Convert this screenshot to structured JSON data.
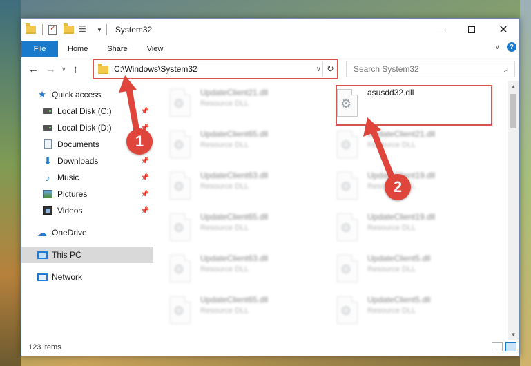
{
  "window": {
    "title": "System32",
    "controls": {
      "minimize": "—",
      "maximize": "□",
      "close": "✕"
    }
  },
  "ribbon": {
    "tabs": [
      "File",
      "Home",
      "Share",
      "View"
    ],
    "help": "?"
  },
  "navbar": {
    "address": "C:\\Windows\\System32",
    "search_placeholder": "Search System32"
  },
  "navpane": {
    "items": [
      {
        "label": "Quick access",
        "icon": "star-icon",
        "pinned": false
      },
      {
        "label": "Local Disk (C:)",
        "icon": "drive-icon",
        "pinned": true
      },
      {
        "label": "Local Disk (D:)",
        "icon": "drive-icon",
        "pinned": true
      },
      {
        "label": "Documents",
        "icon": "documents-icon",
        "pinned": true
      },
      {
        "label": "Downloads",
        "icon": "downloads-icon",
        "pinned": true
      },
      {
        "label": "Music",
        "icon": "music-icon",
        "pinned": true
      },
      {
        "label": "Pictures",
        "icon": "pictures-icon",
        "pinned": true
      },
      {
        "label": "Videos",
        "icon": "videos-icon",
        "pinned": true
      },
      {
        "label": "OneDrive",
        "icon": "cloud-icon",
        "pinned": false
      },
      {
        "label": "This PC",
        "icon": "monitor-icon",
        "pinned": false,
        "selected": true
      },
      {
        "label": "Network",
        "icon": "network-icon",
        "pinned": false
      }
    ]
  },
  "files": [
    {
      "name": "UpdateClient21.dll",
      "type": "Resource DLL",
      "highlighted": false
    },
    {
      "name": "asusdd32.dll",
      "type": "",
      "highlighted": true
    },
    {
      "name": "UpdateClient65.dll",
      "type": "Resource DLL",
      "highlighted": false
    },
    {
      "name": "UpdateClient21.dll",
      "type": "Resource DLL",
      "highlighted": false
    },
    {
      "name": "UpdateClient63.dll",
      "type": "Resource DLL",
      "highlighted": false
    },
    {
      "name": "UpdateClient19.dll",
      "type": "Resource DLL",
      "highlighted": false
    },
    {
      "name": "UpdateClient65.dll",
      "type": "Resource DLL",
      "highlighted": false
    },
    {
      "name": "UpdateClient19.dll",
      "type": "Resource DLL",
      "highlighted": false
    },
    {
      "name": "UpdateClient63.dll",
      "type": "Resource DLL",
      "highlighted": false
    },
    {
      "name": "UpdateClient5.dll",
      "type": "Resource DLL",
      "highlighted": false
    },
    {
      "name": "UpdateClient65.dll",
      "type": "Resource DLL",
      "highlighted": false
    },
    {
      "name": "UpdateClient5.dll",
      "type": "Resource DLL",
      "highlighted": false
    }
  ],
  "markers": [
    "1",
    "2"
  ],
  "status": {
    "item_count": "123 items"
  },
  "colors": {
    "accent": "#1979ca",
    "annotation": "#e0453c"
  }
}
